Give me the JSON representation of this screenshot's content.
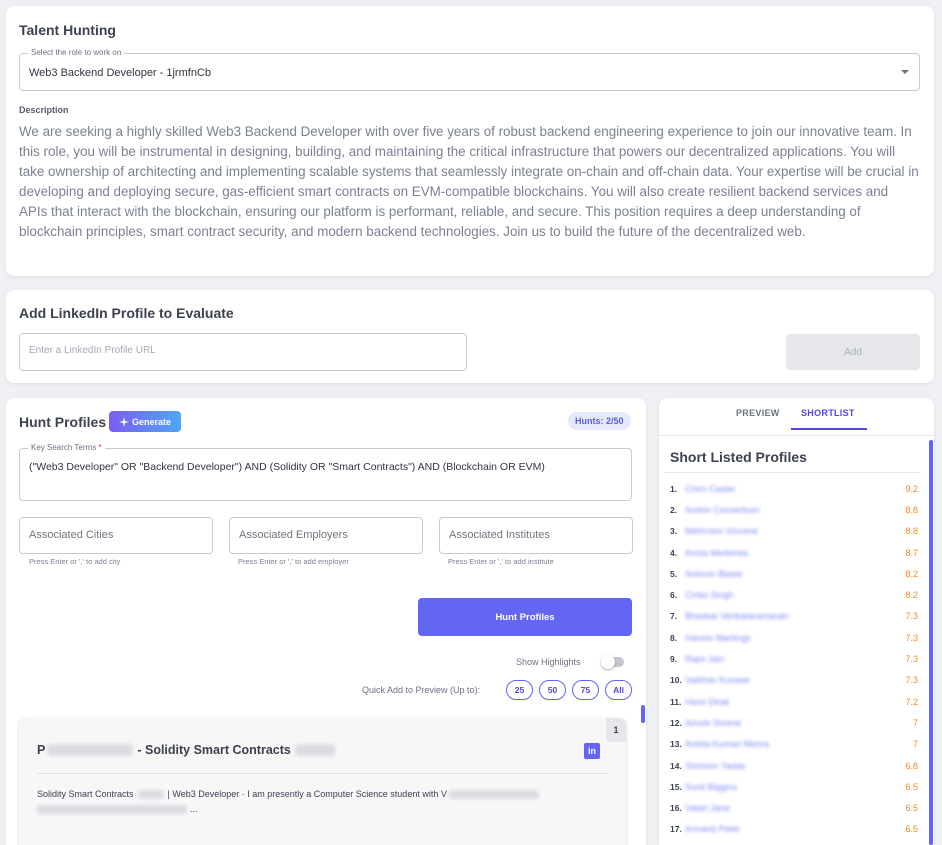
{
  "role_card": {
    "title": "Talent Hunting",
    "select_label": "Select the role to work on",
    "selected_role": "Web3 Backend Developer - 1jrmfnCb",
    "description_label": "Description",
    "description": "We are seeking a highly skilled Web3 Backend Developer with over five years of robust backend engineering experience to join our innovative team. In this role, you will be instrumental in designing, building, and maintaining the critical infrastructure that powers our decentralized applications. You will take ownership of architecting and implementing scalable systems that seamlessly integrate on-chain and off-chain data. Your expertise will be crucial in developing and deploying secure, gas-efficient smart contracts on EVM-compatible blockchains. You will also create resilient backend services and APIs that interact with the blockchain, ensuring our platform is performant, reliable, and secure. This position requires a deep understanding of blockchain principles, smart contract security, and modern backend technologies. Join us to build the future of the decentralized web."
  },
  "linkedin_card": {
    "title": "Add LinkedIn Profile to Evaluate",
    "input_placeholder": "Enter a LinkedIn Profile URL",
    "add_label": "Add"
  },
  "hunt_card": {
    "title": "Hunt Profiles",
    "generate_label": "Generate",
    "hunts_badge": "Hunts: 2/50",
    "search_terms_label": "Key Search Terms",
    "search_terms_required": "*",
    "search_terms_value": "(\"Web3 Developer\" OR \"Backend Developer\") AND (Solidity OR \"Smart Contracts\") AND (Blockchain OR EVM)",
    "cities_placeholder": "Associated Cities",
    "cities_helper": "Press Enter or ',' to add city",
    "employers_placeholder": "Associated Employers",
    "employers_helper": "Press Enter or ',' to add employer",
    "institutes_placeholder": "Associated Institutes",
    "institutes_helper": "Press Enter or ',' to add institute",
    "hunt_button_label": "Hunt Profiles",
    "highlights_label": "Show Highlights",
    "quick_add_label": "Quick Add to Preview (Up to):",
    "quick_add_options": [
      "25",
      "50",
      "75",
      "All"
    ]
  },
  "profile_card": {
    "number": "1",
    "name_initial": "P",
    "name_suffix": "- Solidity Smart Contracts",
    "snippet_start": "Solidity Smart Contracts",
    "snippet_mid": "| Web3 Developer · I am presently a Computer Science student with V",
    "snippet_line2_end": "..."
  },
  "shortlist_card": {
    "tab_preview": "PREVIEW",
    "tab_shortlist": "SHORTLIST",
    "title": "Short Listed Profiles",
    "items": [
      {
        "rank": "1.",
        "name": "Chirn Caster",
        "score": "9.2"
      },
      {
        "rank": "2.",
        "name": "Andrin Convertium",
        "score": "8.8"
      },
      {
        "rank": "3.",
        "name": "Mehrnom Vincene",
        "score": "8.8"
      },
      {
        "rank": "4.",
        "name": "Annia Medeirea",
        "score": "8.7"
      },
      {
        "rank": "5.",
        "name": "Antonin Blasie",
        "score": "8.2"
      },
      {
        "rank": "6.",
        "name": "Cirlas Singh",
        "score": "8.2"
      },
      {
        "rank": "7.",
        "name": "Bhaskar Venkataramanan",
        "score": "7.3"
      },
      {
        "rank": "8.",
        "name": "Hanoin Martings",
        "score": "7.3"
      },
      {
        "rank": "9.",
        "name": "Rajni Jain",
        "score": "7.3"
      },
      {
        "rank": "10.",
        "name": "Vaibhav Kunwar",
        "score": "7.3"
      },
      {
        "rank": "11.",
        "name": "Hemi Dinal",
        "score": "7.2"
      },
      {
        "rank": "12.",
        "name": "Amole Shreve",
        "score": "7"
      },
      {
        "rank": "13.",
        "name": "Ankita Kumari Mehra",
        "score": "7"
      },
      {
        "rank": "14.",
        "name": "Shrimon Yadav",
        "score": "6.8"
      },
      {
        "rank": "15.",
        "name": "Sunil Biggins",
        "score": "6.5"
      },
      {
        "rank": "16.",
        "name": "Vatari Jane",
        "score": "6.5"
      },
      {
        "rank": "17.",
        "name": "Annand Peter",
        "score": "6.5"
      }
    ]
  }
}
